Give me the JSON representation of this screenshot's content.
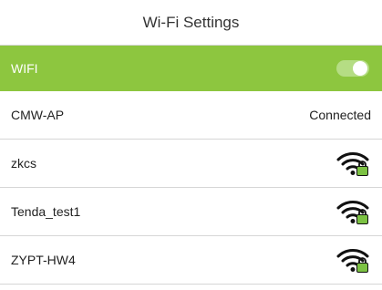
{
  "header": {
    "title": "Wi-Fi Settings"
  },
  "wifi_toggle": {
    "label": "WIFI",
    "enabled": true
  },
  "networks": [
    {
      "ssid": "CMW-AP",
      "status": "Connected",
      "icon": null
    },
    {
      "ssid": "zkcs",
      "status": "",
      "icon": "wifi-locked-icon"
    },
    {
      "ssid": "Tenda_test1",
      "status": "",
      "icon": "wifi-locked-icon"
    },
    {
      "ssid": "ZYPT-HW4",
      "status": "",
      "icon": "wifi-locked-icon"
    }
  ],
  "colors": {
    "accent": "#8dc63f",
    "toggle_track": "#b5dd84",
    "wifi_icon": "#111111",
    "lock_badge": "#7cc243"
  }
}
